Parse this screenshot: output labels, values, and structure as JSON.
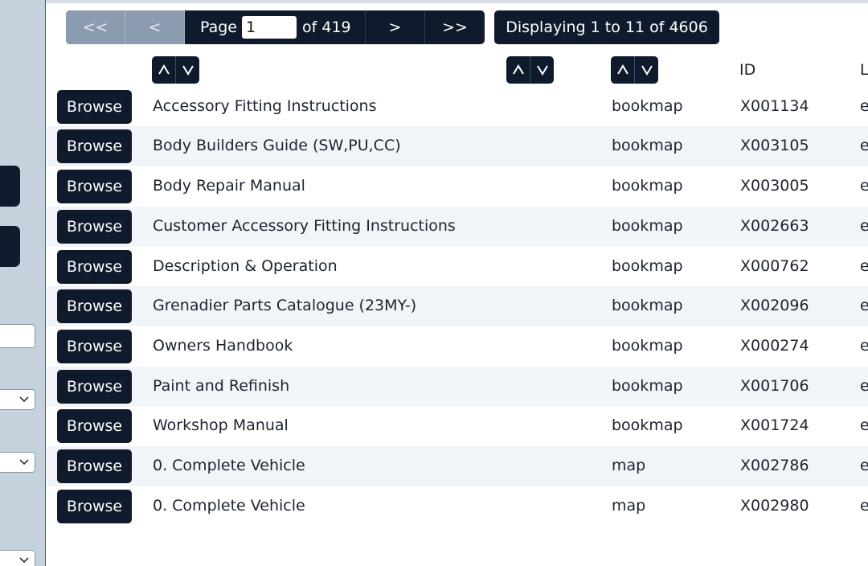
{
  "pagination": {
    "first_label": "<<",
    "prev_label": "<",
    "page_label": "Page",
    "page_value": "1",
    "of_label": "of 419",
    "next_label": ">",
    "last_label": ">>",
    "display_text": "Displaying 1 to 11 of 4606"
  },
  "table": {
    "headers": {
      "id": "ID",
      "lang": "L"
    },
    "browse_label": "Browse",
    "rows": [
      {
        "title": "Accessory Fitting Instructions",
        "type": "bookmap",
        "id": "X001134",
        "lang": "e"
      },
      {
        "title": "Body Builders Guide (SW,PU,CC)",
        "type": "bookmap",
        "id": "X003105",
        "lang": "e"
      },
      {
        "title": "Body Repair Manual",
        "type": "bookmap",
        "id": "X003005",
        "lang": "e"
      },
      {
        "title": "Customer Accessory Fitting Instructions",
        "type": "bookmap",
        "id": "X002663",
        "lang": "e"
      },
      {
        "title": "Description & Operation",
        "type": "bookmap",
        "id": "X000762",
        "lang": "e"
      },
      {
        "title": "Grenadier Parts Catalogue (23MY-)",
        "type": "bookmap",
        "id": "X002096",
        "lang": "e"
      },
      {
        "title": "Owners Handbook",
        "type": "bookmap",
        "id": "X000274",
        "lang": "e"
      },
      {
        "title": "Paint and Refinish",
        "type": "bookmap",
        "id": "X001706",
        "lang": "e"
      },
      {
        "title": "Workshop Manual",
        "type": "bookmap",
        "id": "X001724",
        "lang": "e"
      },
      {
        "title": "0. Complete Vehicle",
        "type": "map",
        "id": "X002786",
        "lang": "e"
      },
      {
        "title": "0. Complete Vehicle",
        "type": "map",
        "id": "X002980",
        "lang": "e"
      }
    ]
  },
  "colors": {
    "primary": "#0f1b2d",
    "disabled": "#8b9bb0",
    "sidebar": "#c5d2dd",
    "row_alt": "#f1f4f8"
  }
}
